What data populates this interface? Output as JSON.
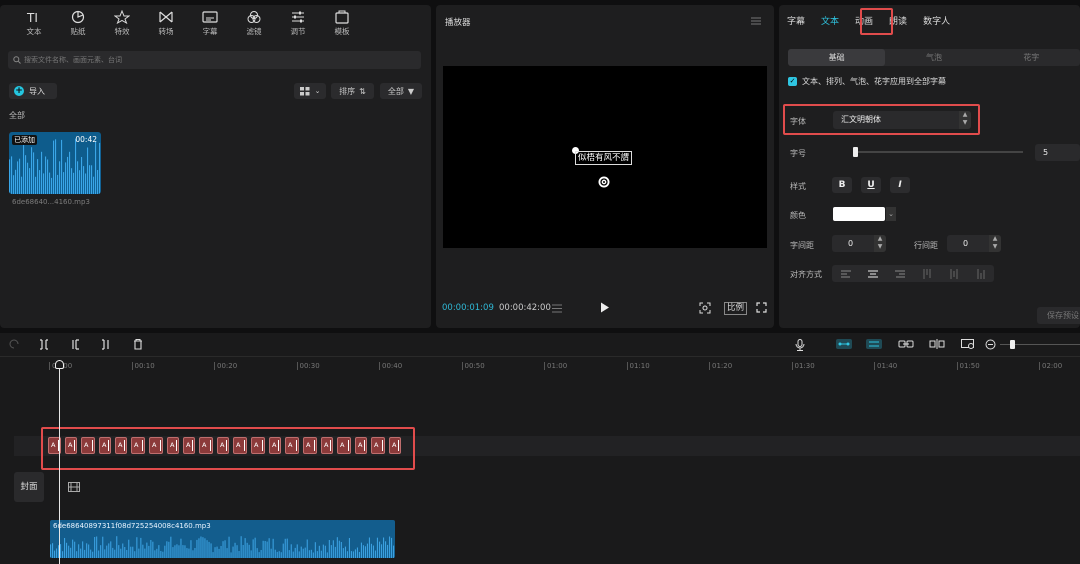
{
  "media": {
    "toolbar": [
      {
        "label": "文本",
        "icon": "text-icon"
      },
      {
        "label": "贴纸",
        "icon": "sticker-icon"
      },
      {
        "label": "特效",
        "icon": "effects-icon"
      },
      {
        "label": "转场",
        "icon": "transition-icon"
      },
      {
        "label": "字幕",
        "icon": "subtitle-icon"
      },
      {
        "label": "滤镜",
        "icon": "filter-icon"
      },
      {
        "label": "调节",
        "icon": "adjust-icon"
      },
      {
        "label": "模板",
        "icon": "template-icon"
      }
    ],
    "search_placeholder": "搜索文件名称、画面元素、台词",
    "import_label": "导入",
    "sort_label": "排序",
    "filter_label": "全部",
    "all_label": "全部",
    "clip": {
      "badge": "已添加",
      "duration": "00:42",
      "filename": "6de68640...4160.mp3"
    }
  },
  "player": {
    "title": "播放器",
    "caption": "似梧有风不謂",
    "current_time": "00:00:01:09",
    "total_time": "00:00:42:00",
    "ratio_label": "比例"
  },
  "props": {
    "tabs": [
      "字幕",
      "文本",
      "动画",
      "朗读",
      "数字人"
    ],
    "active_tab": "文本",
    "subtabs": [
      "基础",
      "气泡",
      "花字"
    ],
    "apply_all_label": "文本、排列、气泡、花字应用到全部字幕",
    "font_label": "字体",
    "font_value": "汇文明朝体",
    "size_label": "字号",
    "size_value": "5",
    "style_label": "样式",
    "style_buttons": [
      "B",
      "U",
      "I"
    ],
    "color_label": "颜色",
    "letter_spacing_label": "字间距",
    "letter_spacing_value": "0",
    "line_spacing_label": "行间距",
    "line_spacing_value": "0",
    "align_label": "对齐方式",
    "save_preset_label": "保存预设"
  },
  "timeline": {
    "ticks": [
      "00:00",
      "00:10",
      "00:20",
      "00:30",
      "00:40",
      "00:50",
      "01:00",
      "01:10",
      "01:20",
      "01:30",
      "01:40",
      "01:50",
      "02:00"
    ],
    "cover_label": "封面",
    "audio_name": "6de68640897311f08d725254008c4160.mp3",
    "subtitle_clips": [
      "A",
      "A",
      "A",
      "A",
      "A",
      "A",
      "A",
      "A",
      "A",
      "A",
      "A",
      "A",
      "A",
      "A",
      "A",
      "A",
      "A",
      "A",
      "A",
      "A",
      "A"
    ]
  },
  "colors": {
    "accent": "#2fc6e2",
    "highlight": "#e14c4c",
    "audio_clip": "#135d8d",
    "subtitle_clip": "#8b3a3a"
  }
}
